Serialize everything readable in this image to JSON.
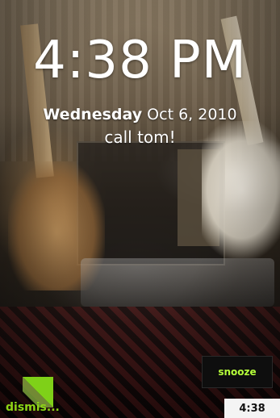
{
  "lockscreen": {
    "time": "4:38 PM",
    "weekday": "Wednesday",
    "date": "Oct 6, 2010",
    "alarm_note": "call tom!"
  },
  "actions": {
    "snooze_label": "snooze",
    "dismiss_label": "dismis..."
  },
  "status": {
    "mini_time": "4:38"
  },
  "colors": {
    "accent": "#b6ff3a",
    "dismiss_green": "#8cd416",
    "snooze_bg": "#0e0e0e"
  }
}
